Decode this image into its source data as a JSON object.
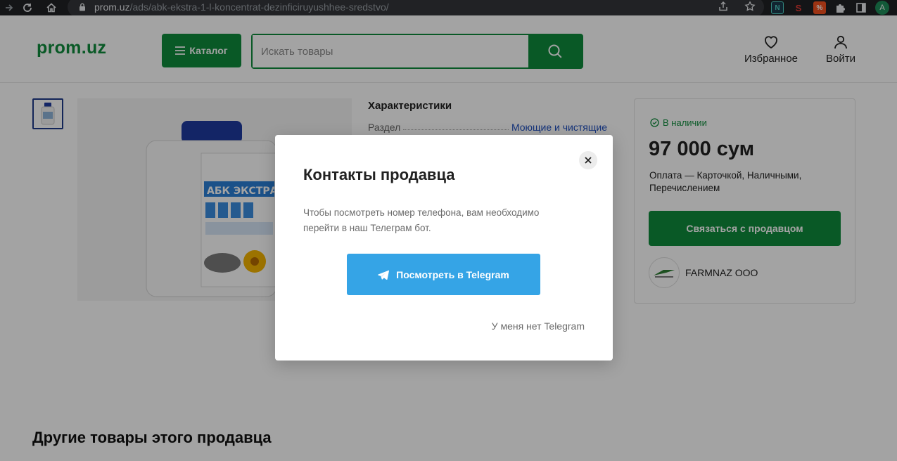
{
  "browser": {
    "url_host": "prom.uz",
    "url_path": "/ads/abk-ekstra-1-l-koncentrat-dezinficiruyushhee-sredstvo/",
    "profile_initial": "A",
    "extensions": [
      "N",
      "S",
      "%"
    ]
  },
  "header": {
    "logo": "prom.uz",
    "catalog_label": "Каталог",
    "search_placeholder": "Искать товары",
    "favorites_label": "Избранное",
    "login_label": "Войти"
  },
  "product": {
    "image_caption": "АБК ЭКСТРА",
    "specs_title": "Характеристики",
    "specs": [
      {
        "key": "Раздел",
        "value": "Моющие и чистящие"
      }
    ]
  },
  "seller_card": {
    "stock": "В наличии",
    "price": "97 000 сум",
    "payment": "Оплата — Карточкой, Наличными, Перечислением",
    "contact_label": "Связаться с продавцом",
    "seller_name": "FARMNAZ OOO"
  },
  "other_title": "Другие товары этого продавца",
  "modal": {
    "title": "Контакты продавца",
    "text": "Чтобы посмотреть номер телефона, вам необходимо перейти в наш Телеграм бот.",
    "telegram_label": "Посмотреть в Telegram",
    "no_telegram_label": "У меня нет Telegram"
  },
  "colors": {
    "brand_green": "#0f8c3c",
    "telegram_blue": "#35a4e6",
    "link_blue": "#1f4fbf"
  }
}
